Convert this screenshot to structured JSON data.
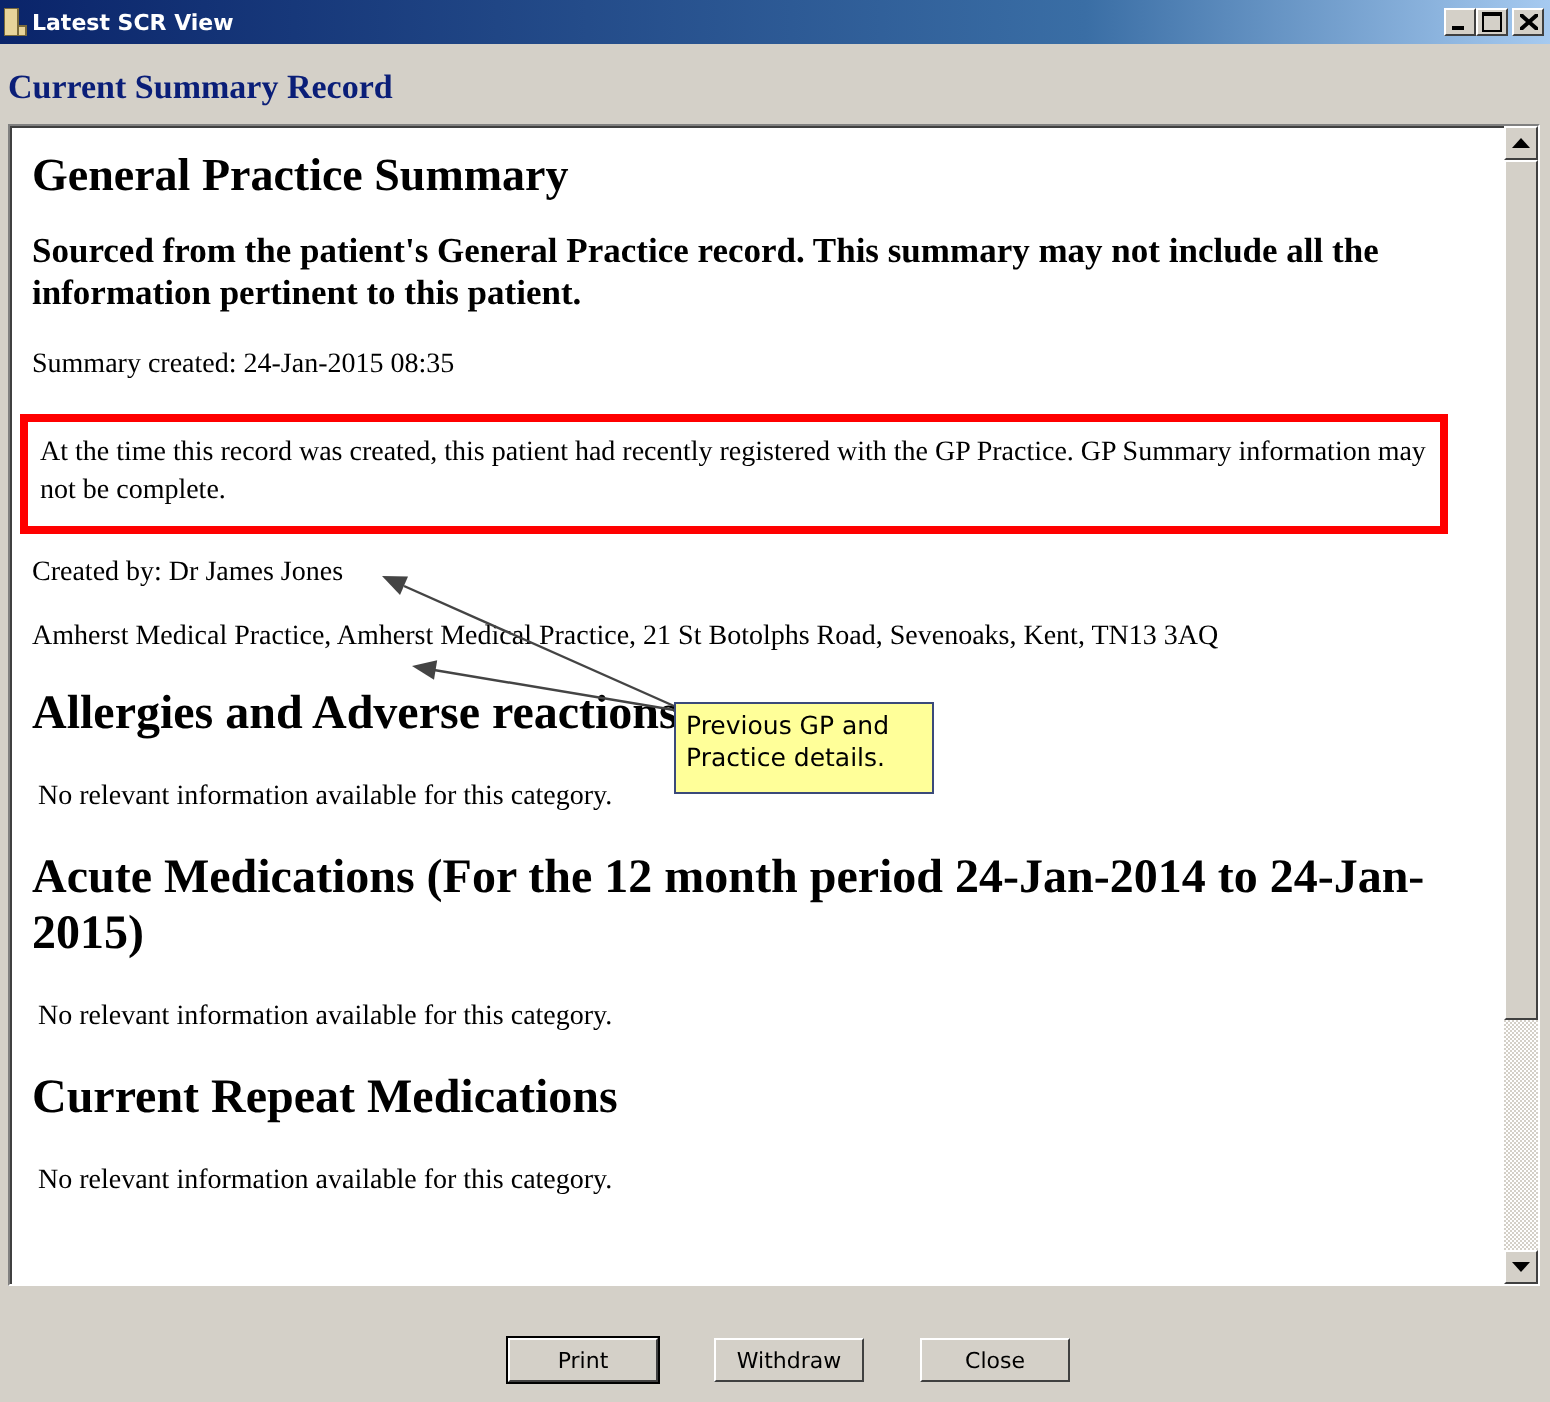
{
  "window": {
    "title": "Latest SCR View"
  },
  "heading": "Current Summary Record",
  "record": {
    "title": "General Practice Summary",
    "intro": "Sourced from the patient's General Practice record. This summary may not include all the information pertinent to this patient.",
    "created": "Summary created: 24-Jan-2015 08:35",
    "notice": "At the time this record was created, this patient had recently registered with the GP Practice. GP Summary information may not be complete.",
    "created_by": "Created by: Dr James Jones",
    "practice": "Amherst Medical Practice, Amherst Medical Practice, 21 St Botolphs Road, Sevenoaks, Kent, TN13 3AQ",
    "sections": [
      {
        "title": "Allergies and Adverse reactions",
        "text": "No relevant information available for this category."
      },
      {
        "title": "Acute Medications (For the 12 month period 24-Jan-2014 to 24-Jan-2015)",
        "text": "No relevant information available for this category."
      },
      {
        "title": "Current Repeat Medications",
        "text": "No relevant information available for this category."
      }
    ]
  },
  "callout": {
    "text": "Previous GP and Practice details."
  },
  "buttons": [
    {
      "label": "Print",
      "focused": true
    },
    {
      "label": "Withdraw",
      "focused": false
    },
    {
      "label": "Close",
      "focused": false
    }
  ]
}
